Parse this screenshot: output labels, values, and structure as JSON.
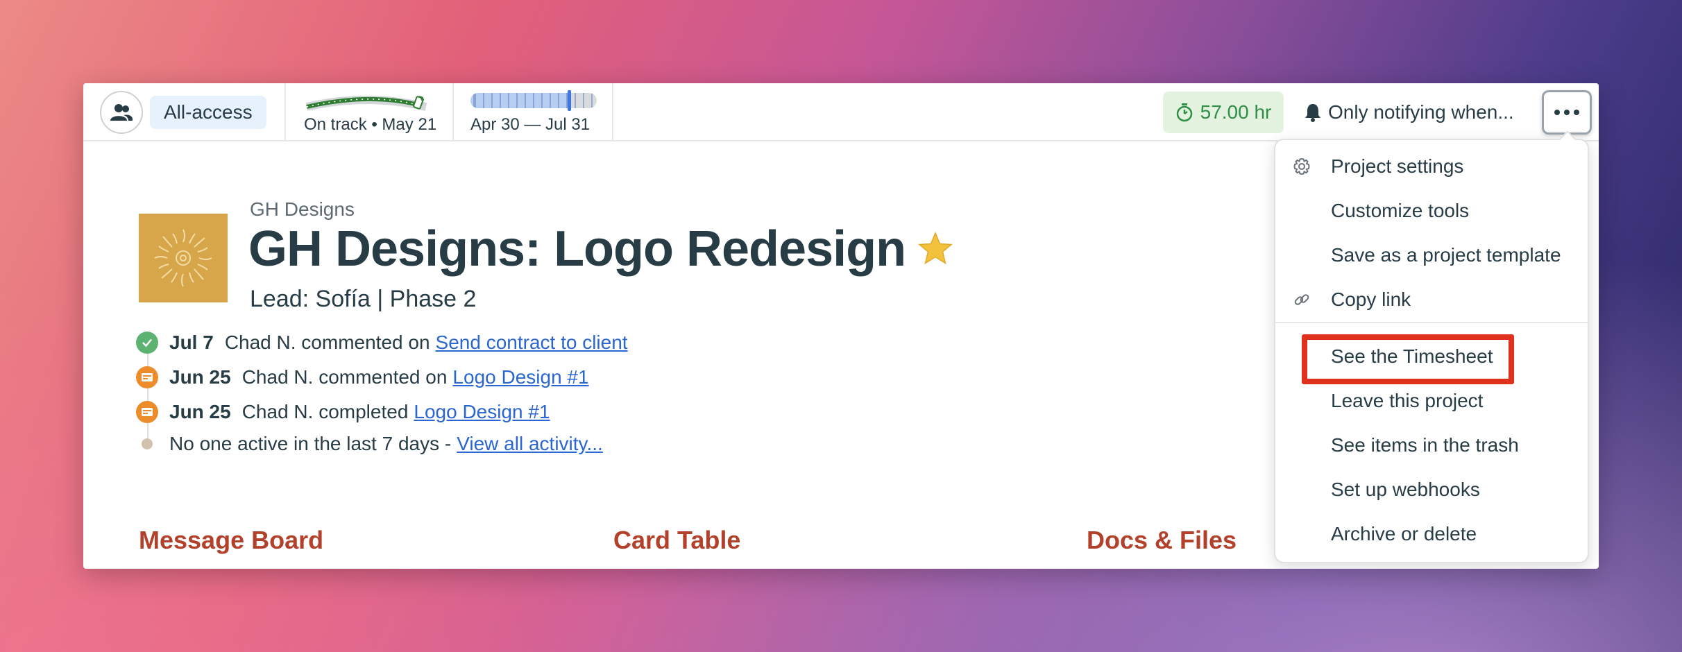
{
  "topbar": {
    "access_label": "All-access",
    "hill_label": "On track • May 21",
    "schedule_label": "Apr 30 — Jul 31",
    "schedule_progress": 0.78,
    "hours_label": "57.00 hr",
    "notify_label": "Only notifying when...",
    "icons": {
      "people": "people-icon",
      "timer": "stopwatch-icon",
      "bell": "bell-icon",
      "more": "ellipsis-icon"
    },
    "colors": {
      "access_badge_bg": "#e7f1fb",
      "hours_badge_bg": "#e3f3df",
      "hours_text": "#2f8f46",
      "hill_green": "#2e7d32"
    }
  },
  "project": {
    "company": "GH Designs",
    "title": "GH Designs: Logo Redesign",
    "star": "★",
    "subtitle": "Lead: Sofía | Phase 2",
    "logo_color": "#d8a64a"
  },
  "activity": [
    {
      "icon": "check-icon",
      "date": "Jul 7",
      "text": "Chad N. commented on",
      "link": "Send contract to client"
    },
    {
      "icon": "card-icon",
      "date": "Jun 25",
      "text": "Chad N. commented on",
      "link": "Logo Design #1"
    },
    {
      "icon": "card-icon",
      "date": "Jun 25",
      "text": "Chad N. completed",
      "link": "Logo Design #1"
    }
  ],
  "activity_footer": {
    "text": "No one active in the last 7 days -",
    "link": "View all activity..."
  },
  "tools": [
    "Message Board",
    "Card Table",
    "Docs & Files"
  ],
  "menu": {
    "items": [
      {
        "label": "Project settings",
        "icon": "gear-icon"
      },
      {
        "label": "Customize tools",
        "icon": ""
      },
      {
        "label": "Save as a project template",
        "icon": ""
      },
      {
        "label": "Copy link",
        "icon": "link-icon"
      },
      {
        "label": "See the Timesheet",
        "icon": "",
        "highlighted": true
      },
      {
        "label": "Leave this project",
        "icon": ""
      },
      {
        "label": "See items in the trash",
        "icon": ""
      },
      {
        "label": "Set up webhooks",
        "icon": ""
      },
      {
        "label": "Archive or delete",
        "icon": ""
      }
    ],
    "highlight_color": "#e0311d"
  }
}
